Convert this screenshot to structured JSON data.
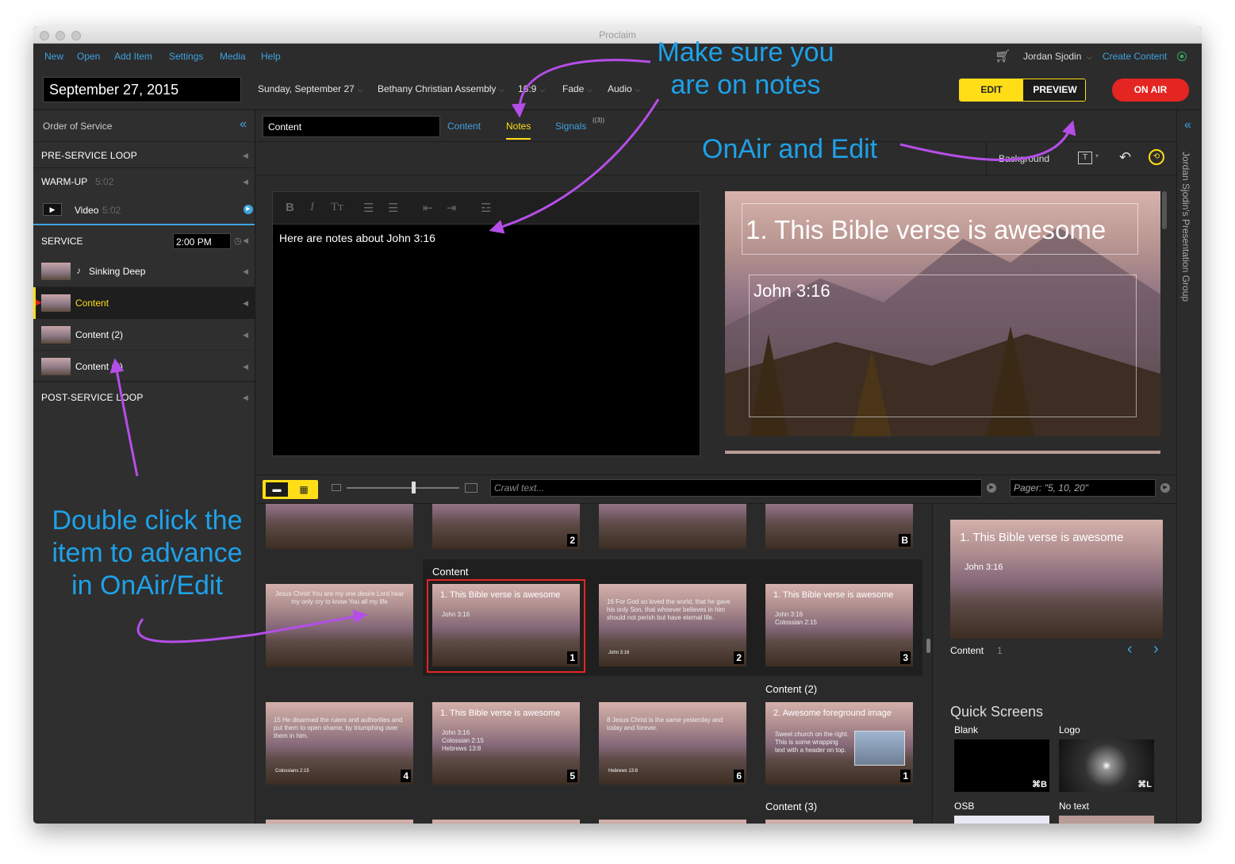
{
  "window": {
    "title": "Proclaim"
  },
  "menu": {
    "items": [
      "New",
      "Open",
      "Add Item",
      "Settings",
      "Media",
      "Help"
    ],
    "user": "Jordan Sjodin",
    "create": "Create Content"
  },
  "topbar": {
    "date": "September 27, 2015",
    "service_date": "Sunday, September 27",
    "church": "Bethany Christian Assembly",
    "aspect": "16:9",
    "transition": "Fade",
    "audio": "Audio",
    "edit": "EDIT",
    "preview": "PREVIEW",
    "onair": "ON AIR"
  },
  "sidebar": {
    "title": "Order of Service",
    "pre_service": "PRE-SERVICE LOOP",
    "warmup": "WARM-UP",
    "warmup_time": "5:02",
    "video": "Video",
    "video_time": "5:02",
    "service": "SERVICE",
    "service_time": "2:00 PM",
    "items": [
      "Sinking Deep",
      "Content",
      "Content (2)",
      "Content (3)"
    ],
    "post_service": "POST-SERVICE LOOP"
  },
  "item": {
    "name": "Content",
    "tabs": {
      "content": "Content",
      "notes": "Notes",
      "signals": "Signals",
      "signals_count": "((3))"
    },
    "background": "Background"
  },
  "editor": {
    "notes_text": "Here are notes about John 3:16"
  },
  "preview_slide": {
    "title": "1. This Bible verse is awesome",
    "body": "John 3:16"
  },
  "pager_bar": {
    "crawl_placeholder": "Crawl text...",
    "pager_placeholder": "Pager: \"5, 10, 20\""
  },
  "grid": {
    "group_content": "Content",
    "group_content2": "Content (2)",
    "group_content3": "Content (3)",
    "top_nums": [
      "2",
      "B"
    ],
    "row2_left_text": "Jesus Christ You are my one desire Lord hear my only cry to know You all my life",
    "slides_content": [
      {
        "title": "1. This Bible verse is awesome",
        "sub": "John 3:16",
        "num": "1"
      },
      {
        "verse": "16 For God so loved the world, that he gave his only Son, that whoever believes in him should not perish but have eternal life.",
        "ref": "John 3:16",
        "num": "2"
      },
      {
        "title": "1. This Bible verse is awesome",
        "sub": "John 3:16\nColossian 2:15",
        "num": "3"
      }
    ],
    "slides_row3": [
      {
        "verse": "15 He disarmed the rulers and authorities and put them to open shame, by triumphing over them in him.",
        "ref": "Colossians 2:15",
        "num": "4"
      },
      {
        "title": "1. This Bible verse is awesome",
        "sub": "John 3:16\nColossian 2:15\nHebrews 13:8",
        "num": "5"
      },
      {
        "verse": "8 Jesus Christ is the same yesterday and today and forever.",
        "ref": "Hebrews 13:8",
        "num": "6"
      },
      {
        "title": "2. Awesome foreground image",
        "sub": "Sweet church on the right. This is some wrapping text with a header on top.",
        "num": "1"
      }
    ]
  },
  "right_panel": {
    "slide_title": "1. This Bible verse is awesome",
    "slide_sub": "John 3:16",
    "label": "Content",
    "index": "1",
    "quick_screens": "Quick Screens",
    "blank": "Blank",
    "blank_key": "⌘B",
    "logo": "Logo",
    "logo_key": "⌘L",
    "osb": "OSB",
    "no_text": "No text"
  },
  "right_strip": {
    "label": "Jordan Sjodin's Presentation Group"
  },
  "annotations": {
    "notes_line1": "Make sure you",
    "notes_line2": "are on notes",
    "onair_edit": "OnAir and Edit",
    "dbl_line1": "Double click the",
    "dbl_line2": "item to advance",
    "dbl_line3": "in OnAir/Edit"
  },
  "colors": {
    "accent_blue": "#3fa3e0",
    "edit_yellow": "#ffde17",
    "onair_red": "#e52521",
    "annotation_blue": "#1ea1e8",
    "arrow_purple": "#b54ee8"
  }
}
